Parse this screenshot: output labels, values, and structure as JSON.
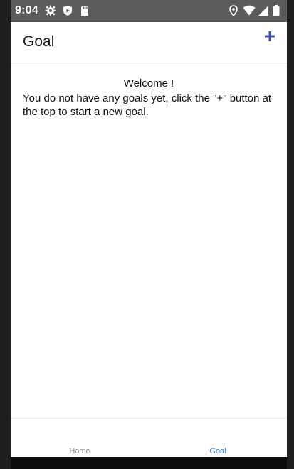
{
  "status_bar": {
    "time": "9:04",
    "left_icons": [
      "settings-icon",
      "shield-play-icon",
      "sd-card-icon"
    ],
    "right_icons": [
      "location-icon",
      "wifi-icon",
      "signal-icon",
      "battery-icon"
    ]
  },
  "app_bar": {
    "title": "Goal",
    "add_icon": "plus-icon",
    "accent_color": "#3f51b5"
  },
  "content": {
    "welcome": "Welcome !",
    "message": "You do not have any goals yet, click the \"+\" button at the top to start a new goal."
  },
  "tabs": [
    {
      "label": "Home",
      "active": false
    },
    {
      "label": "Goal",
      "active": true
    }
  ],
  "colors": {
    "status_bar": "#5b5b5b",
    "active_tab": "#2f7cf6",
    "inactive_tab": "#8a8a8a"
  }
}
